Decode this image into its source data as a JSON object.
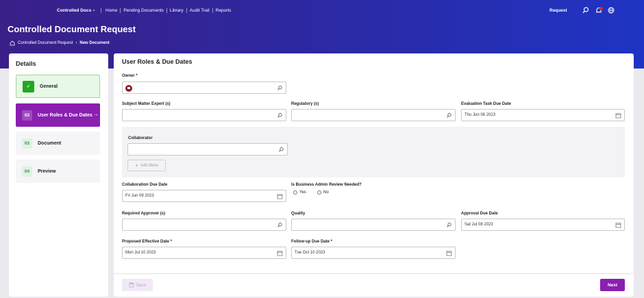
{
  "colors": {
    "accent": "#8a1fb0",
    "header_start": "#3a1f88",
    "header_end": "#1f34c4",
    "success": "#22a81f"
  },
  "topbar": {
    "brand": "Controlled Docs",
    "nav": [
      "Home",
      "Pending Documents",
      "Library",
      "Audit Trail",
      "Reports"
    ],
    "request_link": "Request",
    "icons": [
      "search-icon",
      "bell-icon",
      "globe-icon"
    ]
  },
  "page": {
    "title": "Controlled Document Request",
    "breadcrumb": [
      "Controlled Document Request",
      "New Document"
    ]
  },
  "sidebar": {
    "title": "Details",
    "steps": [
      {
        "num": "✓",
        "label": "General",
        "state": "complete"
      },
      {
        "num": "02",
        "label": "User Roles & Due Dates",
        "state": "active"
      },
      {
        "num": "03",
        "label": "Document",
        "state": "pending"
      },
      {
        "num": "04",
        "label": "Preview",
        "state": "pending"
      }
    ]
  },
  "form": {
    "title": "User Roles & Due Dates",
    "owner": {
      "label": "Owner *",
      "value": ""
    },
    "sme": {
      "label": "Subject Matter Expert (s)",
      "value": ""
    },
    "regulatory": {
      "label": "Regulatory (s)",
      "value": ""
    },
    "eval_due": {
      "label": "Evaluation Task Due Date",
      "value": "Thu Jun 08 2023"
    },
    "collaborator": {
      "label": "Collaborator",
      "value": "",
      "add_more": "Add More"
    },
    "collab_due": {
      "label": "Collaboration Due Date",
      "value": "Fri Jun 09 2023"
    },
    "business_admin": {
      "label": "Is Business Admin Review Needed?",
      "yes": "Yes",
      "no": "No"
    },
    "required_approver": {
      "label": "Required Approver (s)",
      "value": ""
    },
    "quality": {
      "label": "Quality",
      "value": ""
    },
    "approval_due": {
      "label": "Approval Due Date",
      "value": "Sat Jul 08 2023"
    },
    "proposed_effective": {
      "label": "Proposed Effective Date *",
      "value": "Mon Jul 10 2023"
    },
    "followup_due": {
      "label": "Follow-up Due Date *",
      "value": "Tue Oct 10 2023"
    }
  },
  "footer": {
    "save_label": "Save",
    "next_label": "Next"
  }
}
